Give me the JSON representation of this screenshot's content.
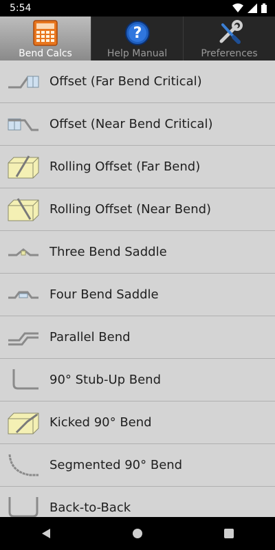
{
  "status": {
    "time": "5:54"
  },
  "tabs": [
    {
      "label": "Bend Calcs",
      "icon": "calculator-icon",
      "active": true
    },
    {
      "label": "Help Manual",
      "icon": "help-icon",
      "active": false
    },
    {
      "label": "Preferences",
      "icon": "wrench-screwdriver-icon",
      "active": false
    }
  ],
  "bends": [
    {
      "label": "Offset (Far Bend Critical)",
      "icon": "offset-far-icon"
    },
    {
      "label": "Offset (Near Bend Critical)",
      "icon": "offset-near-icon"
    },
    {
      "label": "Rolling Offset (Far Bend)",
      "icon": "rolling-offset-far-icon"
    },
    {
      "label": "Rolling Offset (Near Bend)",
      "icon": "rolling-offset-near-icon"
    },
    {
      "label": "Three Bend Saddle",
      "icon": "three-bend-saddle-icon"
    },
    {
      "label": "Four Bend Saddle",
      "icon": "four-bend-saddle-icon"
    },
    {
      "label": "Parallel Bend",
      "icon": "parallel-bend-icon"
    },
    {
      "label": "90° Stub-Up Bend",
      "icon": "stub-up-icon"
    },
    {
      "label": "Kicked 90° Bend",
      "icon": "kicked-90-icon"
    },
    {
      "label": "Segmented 90° Bend",
      "icon": "segmented-90-icon"
    },
    {
      "label": "Back-to-Back",
      "icon": "back-to-back-icon"
    }
  ],
  "colors": {
    "accent": "#e8761e",
    "help_blue": "#1f5fbf"
  }
}
